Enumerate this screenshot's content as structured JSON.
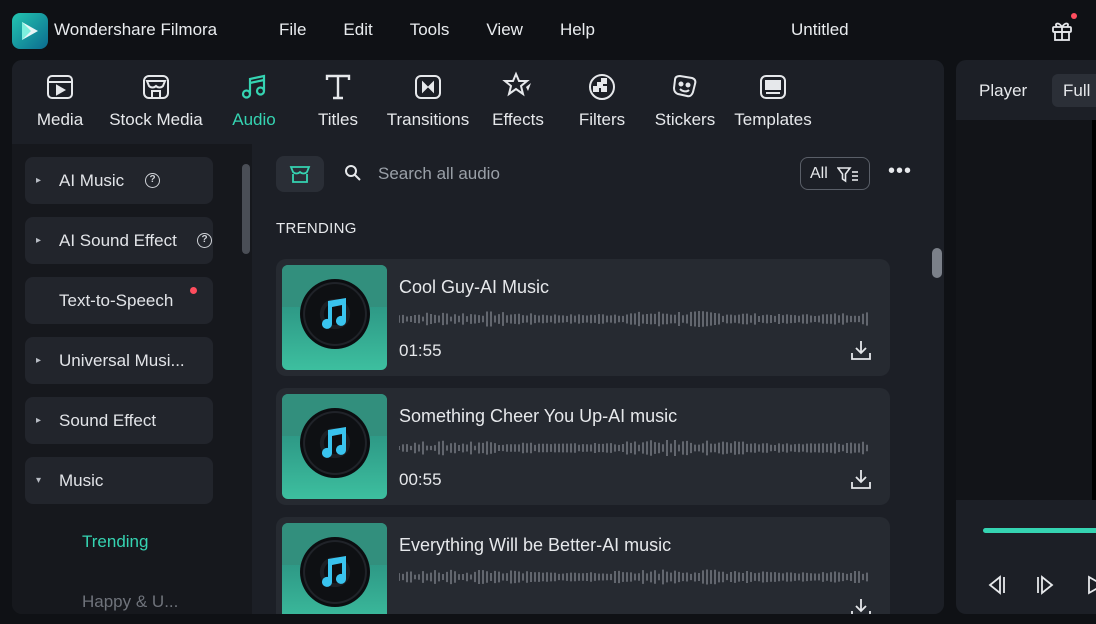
{
  "app": {
    "name": "Wondershare Filmora",
    "document_title": "Untitled"
  },
  "menu": [
    "File",
    "Edit",
    "Tools",
    "View",
    "Help"
  ],
  "toolbar": {
    "tabs": [
      {
        "label": "Media",
        "icon": "media-icon",
        "active": false
      },
      {
        "label": "Stock Media",
        "icon": "stock-media-icon",
        "active": false
      },
      {
        "label": "Audio",
        "icon": "music-note-icon",
        "active": true
      },
      {
        "label": "Titles",
        "icon": "titles-icon",
        "active": false
      },
      {
        "label": "Transitions",
        "icon": "transitions-icon",
        "active": false
      },
      {
        "label": "Effects",
        "icon": "effects-icon",
        "active": false
      },
      {
        "label": "Filters",
        "icon": "filters-icon",
        "active": false
      },
      {
        "label": "Stickers",
        "icon": "stickers-icon",
        "active": false
      },
      {
        "label": "Templates",
        "icon": "templates-icon",
        "active": false
      }
    ]
  },
  "sidebar": {
    "categories": [
      {
        "label": "AI Music",
        "arrow": "▸",
        "help": "?"
      },
      {
        "label": "AI Sound Effect",
        "arrow": "▸",
        "help": "?"
      },
      {
        "label": "Text-to-Speech",
        "badge": "new-dot"
      },
      {
        "label": "Universal Musi...",
        "arrow": "▸"
      },
      {
        "label": "Sound Effect",
        "arrow": "▸"
      },
      {
        "label": "Music",
        "arrow": "▾",
        "expanded": true
      }
    ],
    "subitems": [
      {
        "label": "Trending",
        "active": true
      },
      {
        "label": "Happy & U...",
        "active": false
      }
    ]
  },
  "search": {
    "placeholder": "Search all audio",
    "filter_label": "All",
    "more": "•••"
  },
  "section_title": "TRENDING",
  "tracks": [
    {
      "title": "Cool Guy-AI Music",
      "duration": "01:55"
    },
    {
      "title": "Something Cheer You Up-AI music",
      "duration": "00:55"
    },
    {
      "title": "Everything Will be Better-AI music",
      "duration": ""
    }
  ],
  "player": {
    "tab_label": "Player",
    "quality_label": "Full"
  },
  "colors": {
    "accent": "#35d4b2",
    "panel": "#1c1f26",
    "card": "#262a31",
    "notify": "#ff4d5e"
  }
}
